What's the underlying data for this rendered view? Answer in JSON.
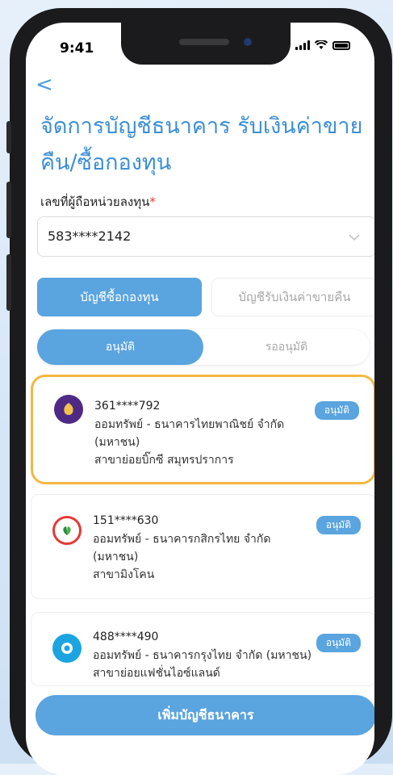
{
  "status": {
    "time": "9:41"
  },
  "nav": {
    "back_icon": "chevron-left-icon",
    "back_glyph": "<"
  },
  "page": {
    "title": "จัดการบัญชีธนาคาร รับเงินค่าขายคืน/ซื้อกองทุน"
  },
  "holder": {
    "label": "เลขที่ผู้ถือหน่วยลงทุน",
    "required_mark": "*",
    "value": "583****2142"
  },
  "tabs": [
    {
      "label": "บัญชีซื้อกองทุน",
      "active": true
    },
    {
      "label": "บัญชีรับเงินค่าขายคืน",
      "active": false
    }
  ],
  "filters": [
    {
      "label": "อนุมัติ",
      "active": true
    },
    {
      "label": "รออนุมัติ",
      "active": false
    }
  ],
  "accounts": [
    {
      "number": "361****792",
      "line1": "ออมทรัพย์ -  ธนาคารไทยพาณิชย์ จำกัด",
      "line2": "(มหาชน)",
      "line3": "สาขาย่อยบิ๊กซี สมุทรปราการ",
      "status": "อนุมัติ",
      "icon": "scb-bank-icon",
      "icon_color": "#4e2a84",
      "selected": true
    },
    {
      "number": "151****630",
      "line1": "ออมทรัพย์ -  ธนาคารกสิกรไทย จำกัด",
      "line2": "(มหาชน)",
      "line3": "สาขามิงโคน",
      "status": "อนุมัติ",
      "icon": "kbank-icon",
      "icon_color": "#2e8b3c",
      "selected": false
    },
    {
      "number": "488****490",
      "line1": "ออมทรัพย์ - ธนาคารกรุงไทย จำกัด (มหาชน)",
      "line2": "สาขาย่อยแฟชั่นไอซ์แลนด์",
      "line3": "",
      "status": "อนุมัติ",
      "icon": "ktb-bank-icon",
      "icon_color": "#1ba5e0",
      "selected": false
    }
  ],
  "add_button": {
    "label": "เพิ่มบัญชีธนาคาร"
  },
  "colors": {
    "accent": "#5aa4df",
    "highlight": "#f5b742",
    "title": "#3d8fd6"
  }
}
